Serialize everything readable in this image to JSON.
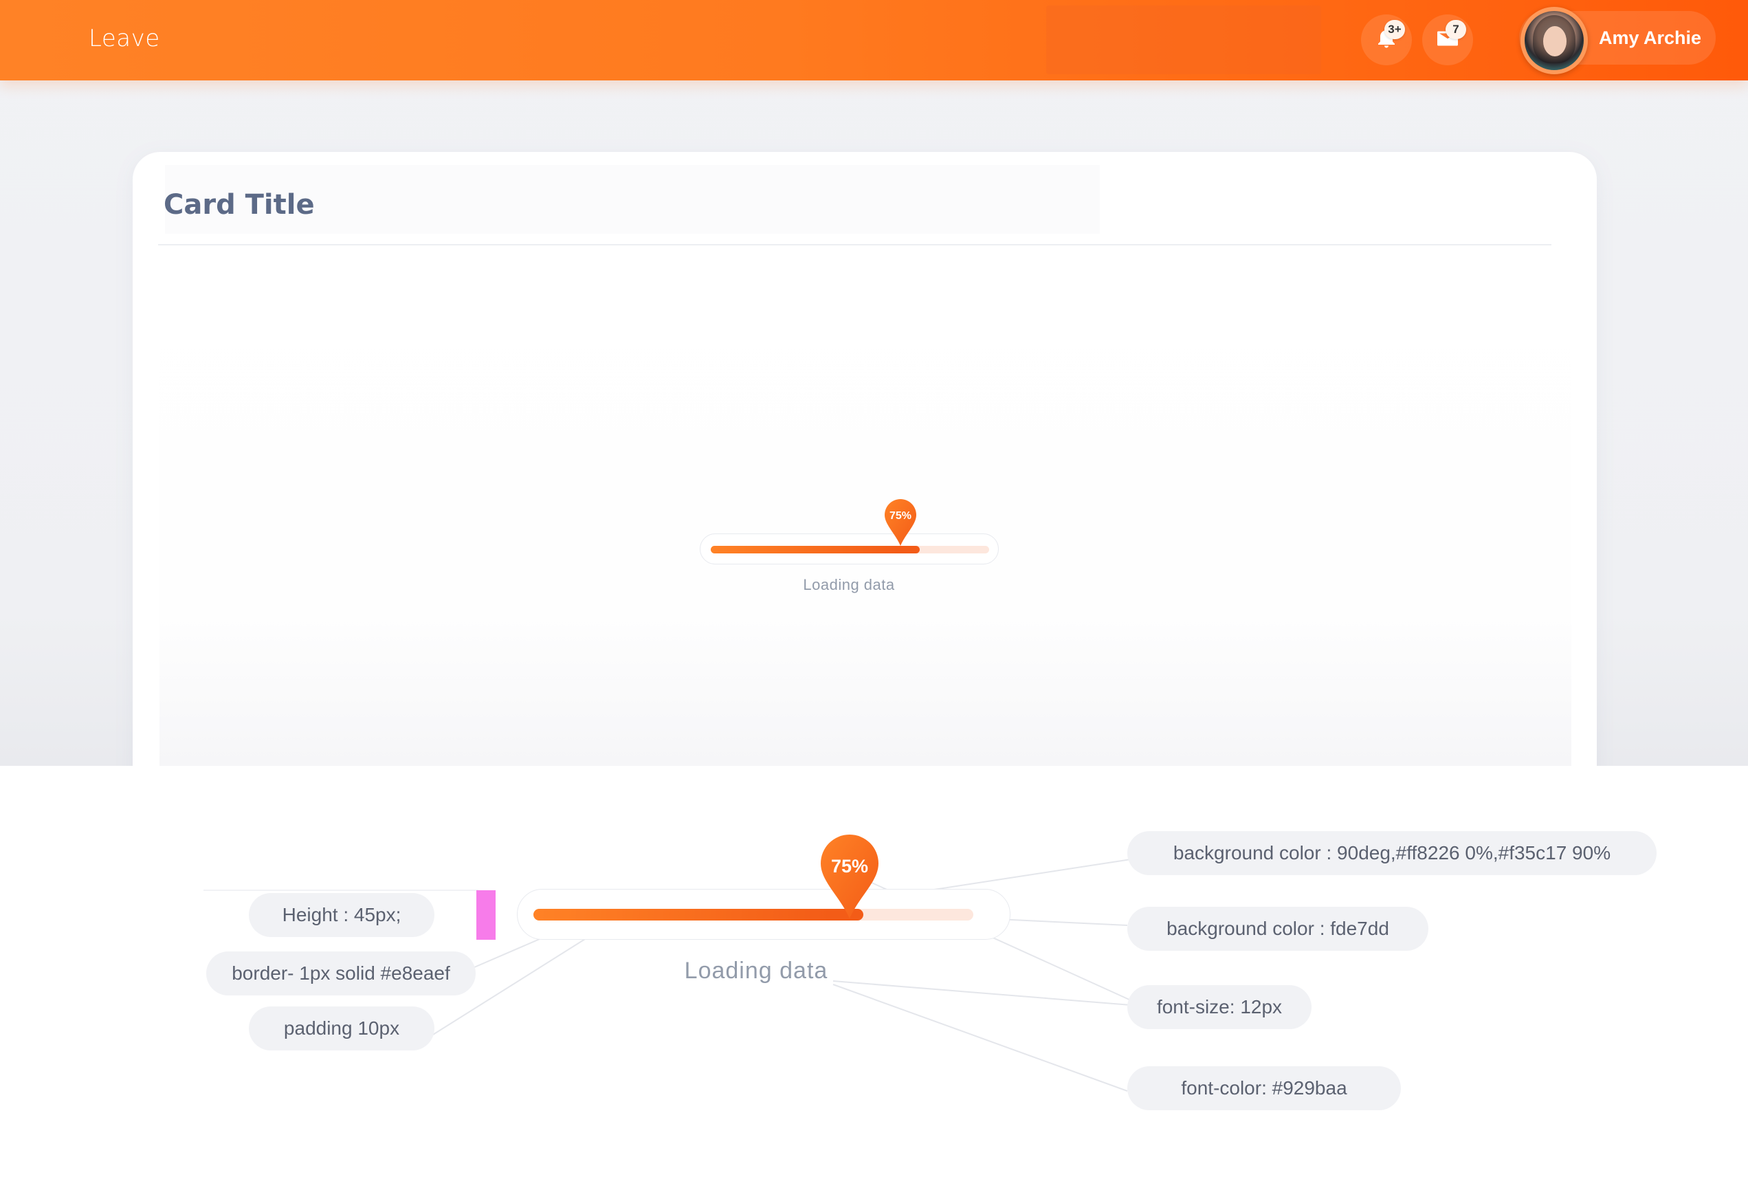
{
  "header": {
    "brand": "Leave",
    "notifications_badge": "3+",
    "messages_badge": "7",
    "user_name": "Amy Archie",
    "icons": [
      "bell-icon",
      "mail-icon"
    ]
  },
  "card": {
    "title": "Card Title",
    "loader": {
      "percent_label": "75%",
      "progress": 0.75,
      "label": "Loading data"
    }
  },
  "spec": {
    "loader": {
      "percent_label": "75%",
      "progress": 0.75,
      "label": "Loading data"
    },
    "annotations_left": [
      "Height : 45px;",
      "border- 1px solid #e8eaef",
      "padding 10px"
    ],
    "annotations_right": [
      "background color  :  90deg,#ff8226 0%,#f35c17 90%",
      "background color  :  fde7dd",
      "font-size: 12px",
      "font-color: #929baa"
    ]
  },
  "colors": {
    "gradient_start": "#ff8226",
    "gradient_end": "#f35c17",
    "track": "#fde7dd",
    "border": "#e8eaef",
    "label_text": "#929baa",
    "marker": "#f77cea"
  }
}
